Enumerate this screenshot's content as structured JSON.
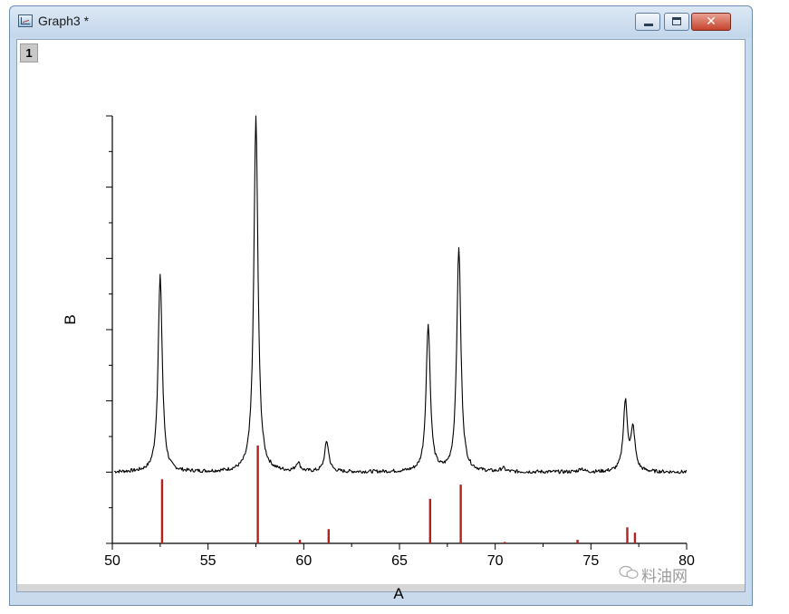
{
  "window": {
    "title": "Graph3 *",
    "layer_label": "1",
    "buttons": {
      "minimize": "minimize",
      "maximize": "maximize",
      "close": "✕"
    }
  },
  "watermark": {
    "text": "料油网"
  },
  "chart_data": {
    "type": "line",
    "xlabel": "A",
    "ylabel": "B",
    "xlim": [
      50,
      80
    ],
    "xticks": [
      50,
      55,
      60,
      65,
      70,
      75,
      80
    ],
    "ylim": [
      0,
      1.2
    ],
    "yticks_major": [
      0,
      0.2,
      0.4,
      0.6,
      0.8,
      1.0,
      1.2
    ],
    "y_tick_labels_shown": false,
    "grid": false,
    "colors": {
      "measured": "#000000",
      "reference": "#b22222"
    },
    "measured_pattern": {
      "baseline": 0.2,
      "noise_amplitude": 0.005,
      "peaks": [
        {
          "x": 52.5,
          "y": 0.75
        },
        {
          "x": 57.5,
          "y": 1.2
        },
        {
          "x": 59.7,
          "y": 0.225
        },
        {
          "x": 61.2,
          "y": 0.285
        },
        {
          "x": 66.5,
          "y": 0.615
        },
        {
          "x": 68.1,
          "y": 0.83
        },
        {
          "x": 70.4,
          "y": 0.21
        },
        {
          "x": 74.5,
          "y": 0.21
        },
        {
          "x": 76.8,
          "y": 0.395
        },
        {
          "x": 77.2,
          "y": 0.315
        }
      ]
    },
    "reference_lines": [
      {
        "x": 52.6,
        "y": 0.18
      },
      {
        "x": 57.6,
        "y": 0.275
      },
      {
        "x": 59.8,
        "y": 0.01
      },
      {
        "x": 61.3,
        "y": 0.04
      },
      {
        "x": 66.6,
        "y": 0.125
      },
      {
        "x": 68.2,
        "y": 0.165
      },
      {
        "x": 70.5,
        "y": 0.004
      },
      {
        "x": 74.3,
        "y": 0.01
      },
      {
        "x": 76.9,
        "y": 0.045
      },
      {
        "x": 77.3,
        "y": 0.03
      }
    ]
  }
}
